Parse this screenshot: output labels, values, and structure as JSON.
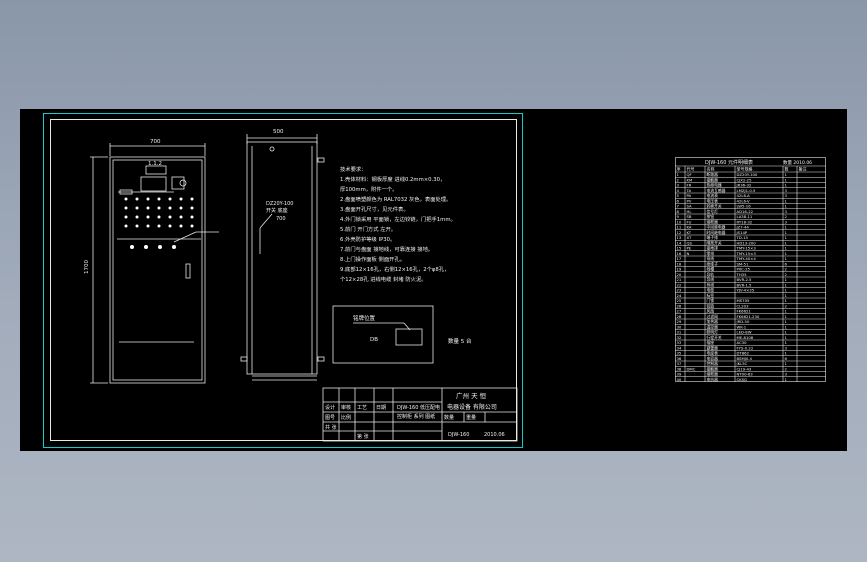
{
  "drawing": {
    "front_width_dim": "700",
    "side_width_dim": "500",
    "height_dim": "1700",
    "top_component_label": "1.1.2",
    "side_component_label": "DZ20Y-100",
    "side_component_sub": "开关 底座",
    "side_component_value": "700"
  },
  "notes": {
    "title": "技术要求：",
    "lines": [
      "1.壳体材料：钢板厚度 进线0.2mm×0.30，",
      "  厚100mm，附件一个。",
      "2.盘面喷塑颜色为 RAL7032 灰色，表面处理。",
      "3.盘面开孔尺寸，见元件表。",
      "4.外门锁采用 平面锁，左边铰链，门把手1mm。",
      "5.前门 开门方式 左开。",
      "6.外壳防护等级 IP30。",
      "7.前门与盘面 接地线，可靠连接 接地。",
      "8.上门操作面板 侧面开孔。",
      "9.底部12×16孔，右侧12×16孔，2个φ8孔，",
      "  个12×28孔 进线电缆 封堵 防火泥。"
    ]
  },
  "nameplate": {
    "label": "铭牌位置",
    "code": "DB",
    "note": "数量 5  台"
  },
  "title_block": {
    "company_line1": "广州 天 恒",
    "company_line2": "电器设备 有限公司",
    "drawing_name_line1": "DJW-160 低压配电",
    "drawing_name_line2": "控制柜 系列 图纸",
    "small_a": "设计",
    "small_b": "审核",
    "small_c": "工艺",
    "small_d": "日期",
    "small_e": "图号",
    "small_f": "比例",
    "small_g": "数量",
    "small_h": "重量",
    "small_i": "共 张",
    "small_j": "第 张",
    "doc_no": "DJW-160",
    "date": "2010.06"
  },
  "bom": {
    "title": "DJW-160 元件明细表",
    "title_right": "数量 2010.06",
    "headers": [
      "序",
      "代号",
      "名称",
      "型号规格",
      "数",
      "备注"
    ],
    "rows": [
      [
        "1",
        "QF",
        "断路器",
        "DZ20Y-100",
        "1",
        ""
      ],
      [
        "2",
        "KM",
        "接触器",
        "CJX2-25",
        "1",
        ""
      ],
      [
        "3",
        "FR",
        "热继电器",
        "JR36-32",
        "1",
        ""
      ],
      [
        "4",
        "TA",
        "电流互感器",
        "LMZJ1-0.5",
        "3",
        ""
      ],
      [
        "5",
        "PA",
        "电流表",
        "42L6-A",
        "3",
        ""
      ],
      [
        "6",
        "PV",
        "电压表",
        "42L6-V",
        "1",
        ""
      ],
      [
        "7",
        "SA",
        "转换开关",
        "LW5-16",
        "1",
        ""
      ],
      [
        "8",
        "HL",
        "信号灯",
        "AD16-22",
        "3",
        ""
      ],
      [
        "9",
        "SB",
        "按钮",
        "LA38-11",
        "2",
        ""
      ],
      [
        "10",
        "FU",
        "熔断器",
        "RT18-32",
        "3",
        ""
      ],
      [
        "11",
        "KA",
        "中间继电器",
        "JZ7-44",
        "1",
        ""
      ],
      [
        "12",
        "KT",
        "时间继电器",
        "JS14P",
        "1",
        ""
      ],
      [
        "13",
        "XT",
        "端子排",
        "TD-15",
        "1",
        ""
      ],
      [
        "14",
        "QS",
        "隔离开关",
        "HD13-200",
        "1",
        ""
      ],
      [
        "15",
        "PE",
        "接地排",
        "TMY-15×3",
        "1",
        ""
      ],
      [
        "16",
        "N",
        "零排",
        "TMY-15×3",
        "1",
        ""
      ],
      [
        "17",
        "",
        "母线",
        "TMY-40×4",
        "1",
        ""
      ],
      [
        "18",
        "",
        "绝缘子",
        "SM-51",
        "6",
        ""
      ],
      [
        "19",
        "",
        "线槽",
        "PXC-25",
        "2",
        ""
      ],
      [
        "20",
        "",
        "导轨",
        "TH35",
        "2",
        ""
      ],
      [
        "21",
        "",
        "导线",
        "BVR-2.5",
        "1",
        ""
      ],
      [
        "22",
        "",
        "导线",
        "BVR-1.5",
        "1",
        ""
      ],
      [
        "23",
        "",
        "电缆",
        "YJV-4×35",
        "1",
        ""
      ],
      [
        "24",
        "",
        "标签",
        "",
        "1",
        ""
      ],
      [
        "25",
        "",
        "门锁",
        "MS705",
        "1",
        ""
      ],
      [
        "26",
        "",
        "铰链",
        "CL203",
        "2",
        ""
      ],
      [
        "27",
        "",
        "风扇",
        "FK6621",
        "1",
        ""
      ],
      [
        "28",
        "",
        "过滤网",
        "FK6621.230",
        "1",
        ""
      ],
      [
        "29",
        "",
        "加热器",
        "JRD-50",
        "1",
        ""
      ],
      [
        "30",
        "",
        "温控器",
        "WK-1",
        "1",
        ""
      ],
      [
        "31",
        "",
        "照明灯",
        "LED-8W",
        "1",
        ""
      ],
      [
        "32",
        "",
        "行程开关",
        "ME-8108",
        "1",
        ""
      ],
      [
        "33",
        "",
        "插座",
        "AC30",
        "1",
        ""
      ],
      [
        "34",
        "",
        "避雷器",
        "FYS-0.22",
        "3",
        ""
      ],
      [
        "35",
        "",
        "电度表",
        "DT862",
        "1",
        ""
      ],
      [
        "36",
        "",
        "电容器",
        "BSMJ0.4",
        "6",
        ""
      ],
      [
        "37",
        "",
        "控制器",
        "JKL5C",
        "1",
        ""
      ],
      [
        "38",
        "DMC",
        "接触器",
        "CJ19-43",
        "2",
        ""
      ],
      [
        "39",
        "",
        "熔断器",
        "NT00-63",
        "3",
        ""
      ],
      [
        "40",
        "",
        "电抗器",
        "CKSG",
        "1",
        ""
      ]
    ]
  },
  "colors": {
    "background": "#8a97a9",
    "canvas": "#000000",
    "frame_cyan": "#17c9c9",
    "lines": "#e8e8e8"
  }
}
